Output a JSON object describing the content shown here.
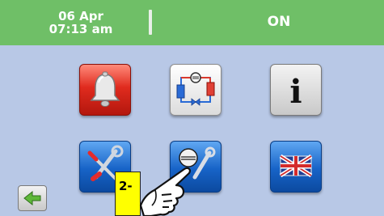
{
  "header": {
    "date": "06 Apr",
    "time": "07:13 am",
    "status": "ON"
  },
  "colors": {
    "topbar": "#6fbf67",
    "background": "#b8c8e6",
    "alarm_tile": "#e02b1e",
    "blue_tile": "#1763c7",
    "step_label": "#ffff00"
  },
  "menu": {
    "tiles": [
      {
        "icon": "bell-icon"
      },
      {
        "icon": "refrigeration-circuit-icon"
      },
      {
        "icon": "info-icon"
      },
      {
        "icon": "settings-tools-icon"
      },
      {
        "icon": "compressor-service-icon"
      },
      {
        "icon": "uk-flag-icon"
      }
    ],
    "info_glyph": "i"
  },
  "annotation": {
    "step_label": "2-",
    "pointer_icon": "pointing-hand-icon"
  },
  "navigation": {
    "back_icon": "back-arrow-icon"
  }
}
